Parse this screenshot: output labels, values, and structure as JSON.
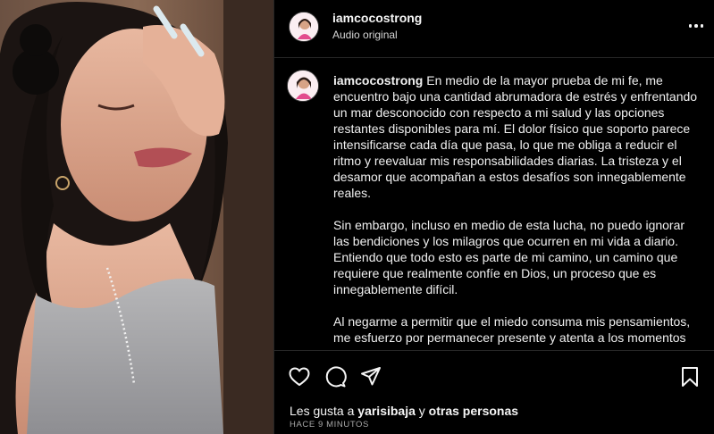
{
  "header": {
    "username": "iamcocostrong",
    "subtitle": "Audio original"
  },
  "caption": {
    "username": "iamcocostrong",
    "paragraphs": [
      "En medio de la mayor prueba de mi fe, me encuentro bajo una cantidad abrumadora de estrés y enfrentando un mar desconocido con respecto a mi salud y las opciones restantes disponibles para mí. El dolor físico que soporto parece intensificarse cada día que pasa, lo que me obliga a reducir el ritmo y reevaluar mis responsabilidades diarias. La tristeza y el desamor que acompañan a estos desafíos son innegablemente reales.",
      "Sin embargo, incluso en medio de esta lucha, no puedo ignorar las bendiciones y los milagros que ocurren en mi vida a diario. Entiendo que todo esto es parte de mi camino, un camino que requiere que realmente confíe en Dios, un proceso que es innegablemente difícil.",
      "Al negarme a permitir que el miedo consuma mis pensamientos, me esfuerzo por permanecer presente y atenta a los momentos"
    ]
  },
  "likes": {
    "prefix": "Les gusta a",
    "user": "yarisibaja",
    "joiner": "y",
    "others": "otras personas"
  },
  "timestamp": "HACE 9 MINUTOS",
  "icons": [
    "more-options-icon",
    "heart-icon",
    "comment-icon",
    "share-icon",
    "bookmark-icon"
  ],
  "colors": {
    "background": "#000000",
    "text": "#f5f5f5",
    "muted": "#a8a8a8",
    "divider": "#262626"
  }
}
